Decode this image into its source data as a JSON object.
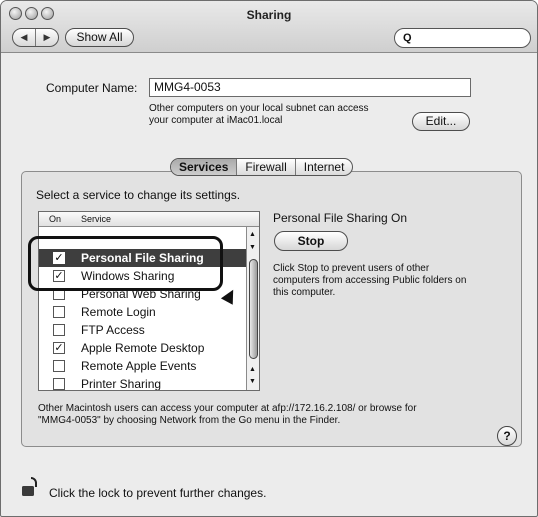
{
  "window": {
    "title": "Sharing"
  },
  "toolbar": {
    "back_label": "◀",
    "forward_label": "▶",
    "show_all_label": "Show All",
    "search_icon": "magnifier-icon",
    "search_value": ""
  },
  "computer": {
    "name_label": "Computer Name:",
    "name_value": "MMG4-0053",
    "info_line1": "Other computers on your local subnet can access",
    "info_line2": "your computer at iMac01.local",
    "edit_label": "Edit..."
  },
  "tabs": [
    "Services",
    "Firewall",
    "Internet"
  ],
  "services": {
    "instruction": "Select a service to change its settings.",
    "col_on": "On",
    "col_service": "Service",
    "rows": [
      {
        "name": "Personal File Sharing",
        "checked": true,
        "selected": true
      },
      {
        "name": "Windows Sharing",
        "checked": true,
        "selected": false
      },
      {
        "name": "Personal Web Sharing",
        "checked": false,
        "selected": false
      },
      {
        "name": "Remote Login",
        "checked": false,
        "selected": false
      },
      {
        "name": "FTP Access",
        "checked": false,
        "selected": false
      },
      {
        "name": "Apple Remote Desktop",
        "checked": true,
        "selected": false
      },
      {
        "name": "Remote Apple Events",
        "checked": false,
        "selected": false
      },
      {
        "name": "Printer Sharing",
        "checked": false,
        "selected": false
      }
    ]
  },
  "status": {
    "title": "Personal File Sharing On",
    "button_label": "Stop",
    "desc_line1": "Click Stop to prevent users of other",
    "desc_line2": "computers from accessing Public folders on",
    "desc_line3": "this computer."
  },
  "footer_info": {
    "line1": "Other Macintosh users can access your computer at afp://172.16.2.108/ or browse for",
    "line2": "\"MMG4-0053\" by choosing Network from the Go menu in the Finder."
  },
  "help_label": "?",
  "lock_text": "Click the lock to prevent further changes."
}
